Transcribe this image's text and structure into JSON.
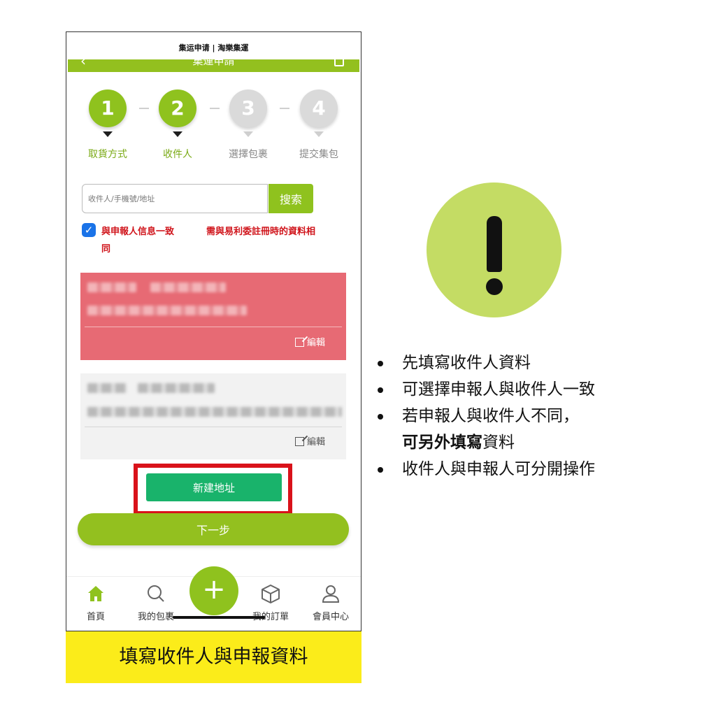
{
  "phone": {
    "status_title": "集运申请 | 淘樂集運",
    "header_title": "集運申請",
    "steps": [
      {
        "number": "1",
        "label": "取貨方式"
      },
      {
        "number": "2",
        "label": "收件人"
      },
      {
        "number": "3",
        "label": "選擇包裹"
      },
      {
        "number": "4",
        "label": "提交集包"
      }
    ],
    "search": {
      "placeholder": "收件人/手機號/地址",
      "button": "搜索"
    },
    "consistency": {
      "label": "與申報人信息一致",
      "note_line1": "需與易利委註冊時的資料相",
      "note_line2": "同"
    },
    "cards": [
      {
        "edit_label": "編輯"
      },
      {
        "edit_label": "編輯"
      }
    ],
    "new_address_button": "新建地址",
    "next_button": "下一步",
    "tabs": [
      {
        "label": "首頁"
      },
      {
        "label": "我的包裹"
      },
      {
        "label": "我的訂單"
      },
      {
        "label": "會員中心"
      }
    ],
    "fab_symbol": "+"
  },
  "caption": "填寫收件人與申報資料",
  "notes": {
    "item1": "先填寫收件人資料",
    "item2": "可選擇申報人與收件人一致",
    "item3_line1": "若申報人與收件人不同，",
    "item3_bold": "可另外填寫",
    "item3_rest": "資料",
    "item4": "收件人與申報人可分開操作"
  },
  "colors": {
    "brand_green": "#8fc21e",
    "accent_green": "#19b36b",
    "warning_red": "#d0141b",
    "caption_yellow": "#fbec1a",
    "alert_circle": "#c4dc64",
    "card_selected": "#e76a74"
  },
  "icons": [
    "chevron-left-icon",
    "box-icon",
    "check-icon",
    "edit-icon",
    "home-icon",
    "search-icon",
    "plus-icon",
    "package-icon",
    "user-icon",
    "exclamation-icon"
  ]
}
